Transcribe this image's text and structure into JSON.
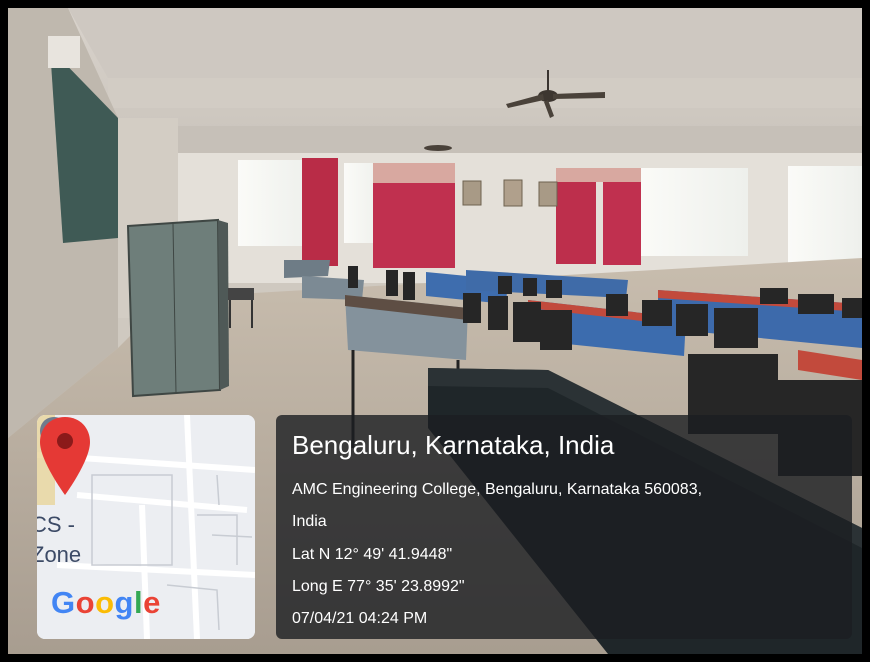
{
  "map": {
    "labels": [
      "CS -",
      "Zone"
    ],
    "logo": [
      "G",
      "o",
      "o",
      "g",
      "l",
      "e"
    ],
    "logo_colors": [
      "#4285F4",
      "#EA4335",
      "#FBBC05",
      "#4285F4",
      "#34A853",
      "#EA4335"
    ],
    "pin_color": "#E53935"
  },
  "location": {
    "title": "Bengaluru, Karnataka, India",
    "address_line1": "AMC Engineering College, Bengaluru, Karnataka 560083,",
    "address_line2": "India",
    "latitude": "Lat N 12° 49' 41.9448\"",
    "longitude": "Long E 77° 35' 23.8992\"",
    "timestamp": "07/04/21 04:24 PM"
  }
}
